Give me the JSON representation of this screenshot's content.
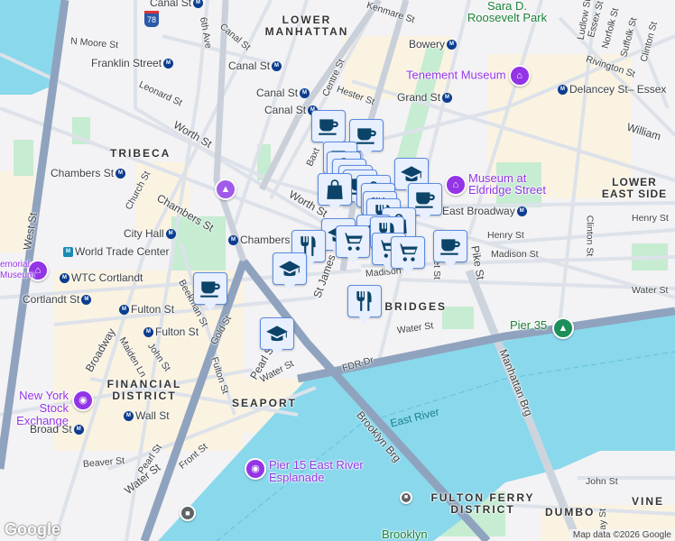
{
  "labels": {
    "canal1": "Canal St",
    "sixth": "6th Ave",
    "canal2": "Canal St",
    "lower_manhattan": "LOWER MANHATTAN",
    "kenmare": "Kenmare St",
    "roosevelt": "Sara D. Roosevelt Park",
    "nmoore": "N Moore St",
    "franklin": "Franklin Street",
    "canal3": "Canal St",
    "bowery": "Bowery",
    "tenement": "Tenement Museum",
    "ludlow": "Ludlow St",
    "essex": "Essex St",
    "norfolk": "Norfolk St",
    "suffolk": "Suffolk St",
    "clinton1": "Clinton St",
    "rivington": "Rivington St",
    "delancey": "Delancey St– Essex",
    "leonard": "Leonard St",
    "canal4": "Canal St",
    "canal5": "Canal St",
    "centre": "Centre St",
    "hester": "Hester St",
    "grand": "Grand St",
    "william": "William",
    "tribeca": "TRIBECA",
    "worth1": "Worth St",
    "chambers1": "Chambers St",
    "church": "Church St",
    "chambers2": "Chambers St",
    "cityhall": "City Hall",
    "chambers3": "Chambers St",
    "wtc": "World Trade Center",
    "worth2": "Worth St",
    "eldridge": "Museum at Eldridge Street",
    "les": "LOWER EAST SIDE",
    "eastbroadway": "East Broadway",
    "henry1": "Henry St",
    "madison1": "Madison St",
    "clinton2": "Clinton St",
    "henry2": "Henry St",
    "pike": "Pike St",
    "west": "West St",
    "memorial": "emorial Museum",
    "wtccortlandt": "WTC Cortlandt",
    "cortlandt": "Cortlandt St",
    "fulton1": "Fulton St",
    "fulton2": "Fulton St",
    "beekman": "Beekman St",
    "gold": "Gold St",
    "broadway": "Broadway",
    "maiden": "Maiden Ln",
    "john1": "John St",
    "fulton3": "Fulton St",
    "fidi": "FINANCIAL DISTRICT",
    "nyse": "New York Stock Exchange",
    "wall": "Wall St",
    "broad": "Broad St",
    "seaport": "SEAPORT",
    "pearl1": "Pearl St",
    "water1": "Water St",
    "stjames": "St James",
    "madison2": "Madison",
    "twobridges": "TWO BRIDGES",
    "water2": "Water St",
    "water3": "Water St",
    "pier35": "Pier 35",
    "fdr": "FDR Dr",
    "manhattanbrg": "Manhattan Brg",
    "eastriver": "East River",
    "brooklynbrg": "Brooklyn Brg",
    "beaver": "Beaver St",
    "pearl2": "Pearl St",
    "water4": "Water St",
    "front": "Front St",
    "pier15": "Pier 15 East River Esplanade",
    "fultonferry": "FULTON FERRY DISTRICT",
    "dumbo": "DUMBO",
    "vine": "VINE",
    "john2": "John St",
    "jay": "Jay St",
    "brooklyn": "Brooklyn",
    "ket": "ket St",
    "interstate": "78"
  },
  "subway_icon": "M",
  "attribution": "Map data ©2026 Google",
  "logo": "Google",
  "markers": [
    {
      "icon": "coffee-cup"
    },
    {
      "icon": "coffee-cup"
    },
    {
      "icon": "coffee-cup"
    },
    {
      "icon": "shopping-bag"
    },
    {
      "icon": "coffee-cup"
    },
    {
      "icon": "shopping-bag"
    },
    {
      "icon": "coffee-cup"
    },
    {
      "icon": "shopping-bag"
    },
    {
      "icon": "graduation-cap"
    },
    {
      "icon": "shopping-bag"
    },
    {
      "icon": "coffee-cup"
    },
    {
      "icon": "coffee-cup"
    },
    {
      "icon": "cutlery"
    },
    {
      "icon": "cutlery"
    },
    {
      "icon": "shopping-bag"
    },
    {
      "icon": "graduation-cap"
    },
    {
      "icon": "cutlery"
    },
    {
      "icon": "graduation-cap"
    },
    {
      "icon": "shopping-cart"
    },
    {
      "icon": "shopping-cart"
    },
    {
      "icon": "shopping-cart"
    },
    {
      "icon": "coffee-cup"
    },
    {
      "icon": "cutlery"
    },
    {
      "icon": "coffee-cup"
    },
    {
      "icon": "graduation-cap"
    }
  ],
  "colors": {
    "water": "#8ad8ec",
    "park": "#c6ecd2",
    "road": "#ffffff",
    "highway": "#8fa3bf",
    "marker_bg": "#e8effe",
    "marker_icon": "#0b4468",
    "poi": "#9334e6"
  }
}
